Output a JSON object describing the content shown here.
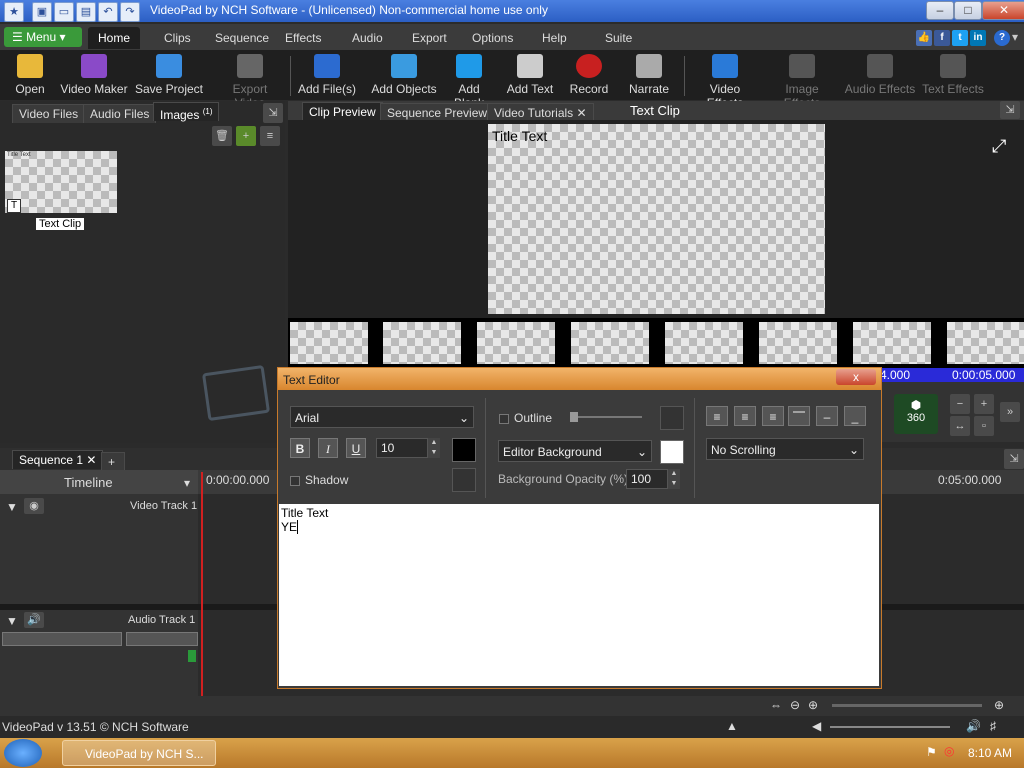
{
  "window": {
    "title": "VideoPad by NCH Software - (Unlicensed) Non-commercial home use only"
  },
  "menubar": {
    "menu_label": "Menu",
    "tabs": [
      "Home",
      "Clips",
      "Sequence",
      "Effects",
      "Audio",
      "Export",
      "Options",
      "Help",
      "Suite"
    ]
  },
  "toolbar": {
    "items": [
      {
        "label": "Open",
        "icon": "folder-open-icon"
      },
      {
        "label": "Video Maker",
        "icon": "video-maker-icon"
      },
      {
        "label": "Save Project",
        "icon": "save-icon"
      },
      {
        "label": "Export Video",
        "icon": "export-video-icon",
        "disabled": true
      },
      {
        "label": "Add File(s)",
        "icon": "add-files-icon"
      },
      {
        "label": "Add Objects",
        "icon": "add-objects-icon"
      },
      {
        "label": "Add Blank",
        "icon": "add-blank-icon"
      },
      {
        "label": "Add Text",
        "icon": "add-text-icon"
      },
      {
        "label": "Record",
        "icon": "record-icon"
      },
      {
        "label": "Narrate",
        "icon": "microphone-icon"
      },
      {
        "label": "Video Effects",
        "icon": "video-effects-icon"
      },
      {
        "label": "Image Effects",
        "icon": "image-effects-icon",
        "disabled": true
      },
      {
        "label": "Audio Effects",
        "icon": "audio-effects-icon",
        "disabled": true
      },
      {
        "label": "Text Effects",
        "icon": "text-effects-icon",
        "disabled": true
      }
    ]
  },
  "bin": {
    "tabs": [
      "Video Files",
      "Audio Files",
      "Images"
    ],
    "images_count": "(1)",
    "thumb_label": "Text Clip",
    "thumb_caption": "Title Text"
  },
  "preview": {
    "tabs": [
      "Clip Preview",
      "Sequence Preview",
      "Video Tutorials"
    ],
    "heading": "Text Clip",
    "overlay_text": "Title Text",
    "time_left": "4.000",
    "time_right": "0:00:05.000"
  },
  "sequence": {
    "tab": "Sequence 1",
    "timeline_label": "Timeline",
    "time_start": "0:00:00.000",
    "time_end": "0:05:00.000",
    "video_track": "Video Track 1",
    "audio_track": "Audio Track 1"
  },
  "text_editor": {
    "title": "Text Editor",
    "font": "Arial",
    "size": "10",
    "bold": "B",
    "italic": "I",
    "underline": "U",
    "outline_label": "Outline",
    "shadow_label": "Shadow",
    "background_option": "Editor Background",
    "opacity_label": "Background Opacity (%):",
    "opacity_value": "100",
    "scroll_option": "No Scrolling",
    "content_line1": "Title Text",
    "content_line2": "YE",
    "close_symbol": "x"
  },
  "statusbar": {
    "version": "VideoPad v 13.51 © NCH Software"
  },
  "taskbar": {
    "app_label": "VideoPad by NCH S...",
    "clock": "8:10 AM"
  },
  "badge_360": "360"
}
